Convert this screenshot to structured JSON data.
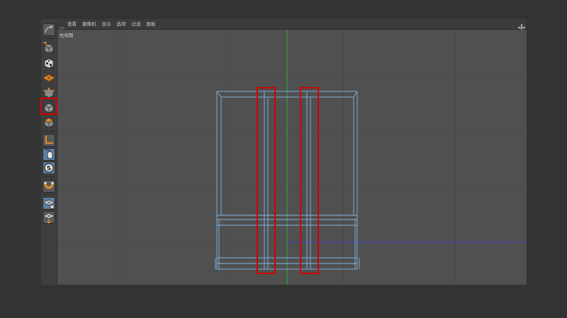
{
  "menubar": {
    "items": [
      "查看",
      "摄像机",
      "显示",
      "选项",
      "过滤",
      "面板"
    ]
  },
  "viewport": {
    "label": "右视图",
    "colors": {
      "background": "#505050",
      "grid": "#454545",
      "wireframe": "#7fb6e6",
      "y_axis": "#2bb52b",
      "z_axis": "#3b3bcc",
      "highlight": "#d40000"
    }
  },
  "toolbar": {
    "tools": [
      {
        "name": "undo-view-icon"
      },
      {
        "name": "model-mode-icon"
      },
      {
        "name": "texture-mode-icon"
      },
      {
        "name": "workplane-mode-icon"
      },
      {
        "name": "points-mode-icon"
      },
      {
        "name": "edges-mode-icon"
      },
      {
        "name": "polygons-mode-icon"
      },
      {
        "name": "axis-mode-icon"
      },
      {
        "name": "tweak-mode-icon"
      },
      {
        "name": "solo-mode-icon"
      },
      {
        "name": "snap-magnet-icon"
      },
      {
        "name": "workplane-lock-icon"
      },
      {
        "name": "planar-workplane-icon"
      }
    ],
    "selected_tool": "polygons-mode-icon"
  }
}
